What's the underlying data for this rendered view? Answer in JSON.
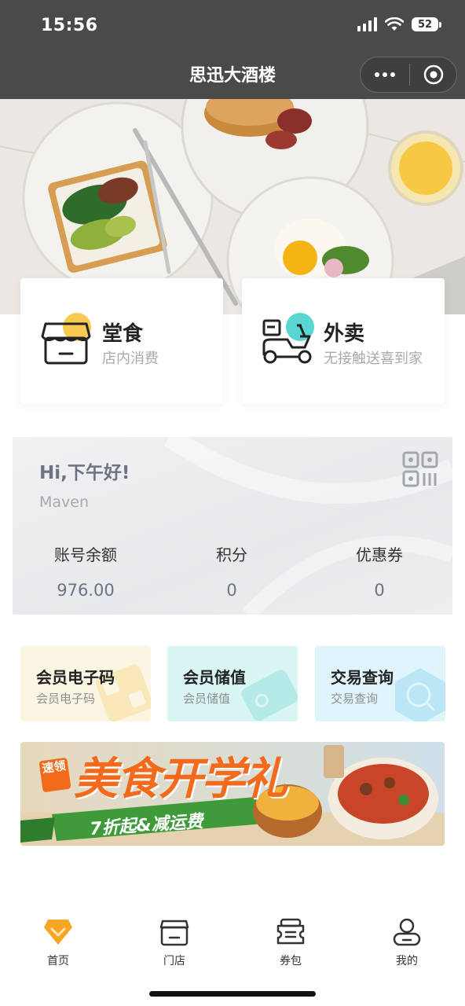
{
  "status_bar": {
    "time": "15:56",
    "battery": "52"
  },
  "nav": {
    "title": "思迅大酒楼"
  },
  "services": [
    {
      "title": "堂食",
      "subtitle": "店内消费"
    },
    {
      "title": "外卖",
      "subtitle": "无接触送喜到家"
    }
  ],
  "member": {
    "greeting": "Hi,下午好!",
    "username": "Maven",
    "stats": [
      {
        "label": "账号余额",
        "value": "976.00"
      },
      {
        "label": "积分",
        "value": "0"
      },
      {
        "label": "优惠券",
        "value": "0"
      }
    ]
  },
  "quick_actions": [
    {
      "title": "会员电子码",
      "subtitle": "会员电子码"
    },
    {
      "title": "会员储值",
      "subtitle": "会员储值"
    },
    {
      "title": "交易查询",
      "subtitle": "交易查询"
    }
  ],
  "promo": {
    "tag": "速领",
    "headline": "美食开学礼",
    "subline": "7折起&减运费"
  },
  "tabs": [
    {
      "label": "首页"
    },
    {
      "label": "门店"
    },
    {
      "label": "券包"
    },
    {
      "label": "我的"
    }
  ],
  "colors": {
    "accent": "#f5a623",
    "topbar": "#4a4a4a",
    "slate": "#6c7384"
  }
}
